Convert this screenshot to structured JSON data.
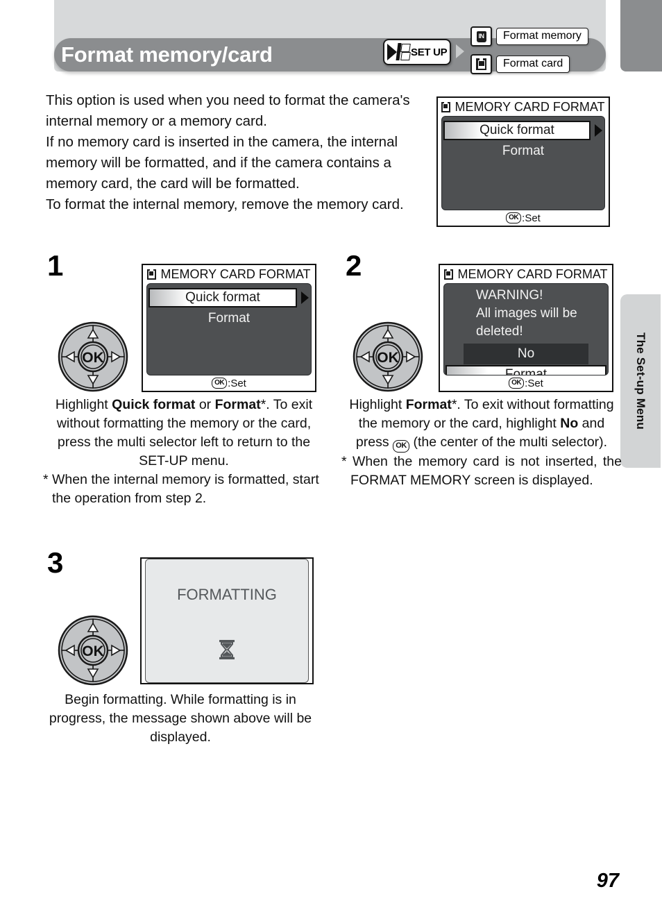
{
  "header": {
    "title": "Format memory/card",
    "setup_button_label": "SET UP",
    "setup_icon": "setup-menu-icon",
    "arrow_icon": "right-arrow-icon",
    "menu_entries": [
      {
        "icon": "internal-memory-icon",
        "icon_text": "IN",
        "label": "Format memory"
      },
      {
        "icon": "memory-card-icon",
        "label": "Format card"
      }
    ]
  },
  "side_tab": {
    "label": "The Set-up Menu"
  },
  "intro": {
    "paragraphs": [
      "This option is used when you need to format the camera's internal memory or a memory card.",
      "If no memory card is inserted in the camera, the internal memory will be formatted, and if the camera contains a memory card, the card will be formatted.",
      "To format the internal memory, remove the memory card."
    ]
  },
  "lcd_top": {
    "title": "MEMORY CARD FORMAT",
    "title_icon": "memory-card-icon",
    "rows": [
      {
        "label": "Quick format",
        "state": "highlighted",
        "arrow": true
      },
      {
        "label": "Format",
        "state": "normal"
      }
    ],
    "footer": "OK",
    "footer_text": ":Set"
  },
  "steps": [
    {
      "number": "1",
      "selector_icon": "multi-selector-dial",
      "lcd": {
        "title": "MEMORY CARD FORMAT",
        "title_icon": "memory-card-icon",
        "rows": [
          {
            "label": "Quick format",
            "state": "highlighted",
            "arrow": true
          },
          {
            "label": "Format",
            "state": "normal"
          }
        ],
        "footer": "OK",
        "footer_text": ":Set"
      },
      "caption_main_pre": "Highlight ",
      "caption_bold_1": "Quick format",
      "caption_mid": " or ",
      "caption_bold_2": "Format",
      "caption_main_post": "*. To exit without formatting the memory or the card, press the multi selector left to return to the SET-UP menu.",
      "footnote": "* When the internal memory is formatted, start the operation from step 2."
    },
    {
      "number": "2",
      "selector_icon": "multi-selector-dial",
      "lcd": {
        "title": "MEMORY CARD FORMAT",
        "title_icon": "memory-card-icon",
        "warning_lines": [
          "WARNING!",
          "All images will be",
          "deleted!"
        ],
        "rows": [
          {
            "label": "No",
            "state": "dark"
          },
          {
            "label": "Format",
            "state": "highlighted"
          }
        ],
        "footer": "OK",
        "footer_text": ":Set"
      },
      "caption_pre": "Highlight ",
      "caption_bold_1": "Format",
      "caption_mid": "*. To exit without formatting the memory or the card, highlight ",
      "caption_bold_2": "No",
      "caption_post_1": " and press ",
      "caption_ok_badge": "OK",
      "caption_post_2": " (the center of the multi selector).",
      "footnote": "* When the memory card is not inserted, the FORMAT MEMORY screen is displayed."
    },
    {
      "number": "3",
      "selector_icon": "multi-selector-dial",
      "lcd": {
        "message": "FORMATTING",
        "icon": "hourglass-icon"
      },
      "caption": "Begin formatting. While formatting is in progress, the message shown above will be displayed."
    }
  ],
  "page_number": "97",
  "colors": {
    "header_band": "#d7d9da",
    "title_bar": "#8b8d8f",
    "lcd_background": "#4e5052",
    "lcd_light_background": "#e7e9ea",
    "side_tab": "#d2d4d5"
  }
}
